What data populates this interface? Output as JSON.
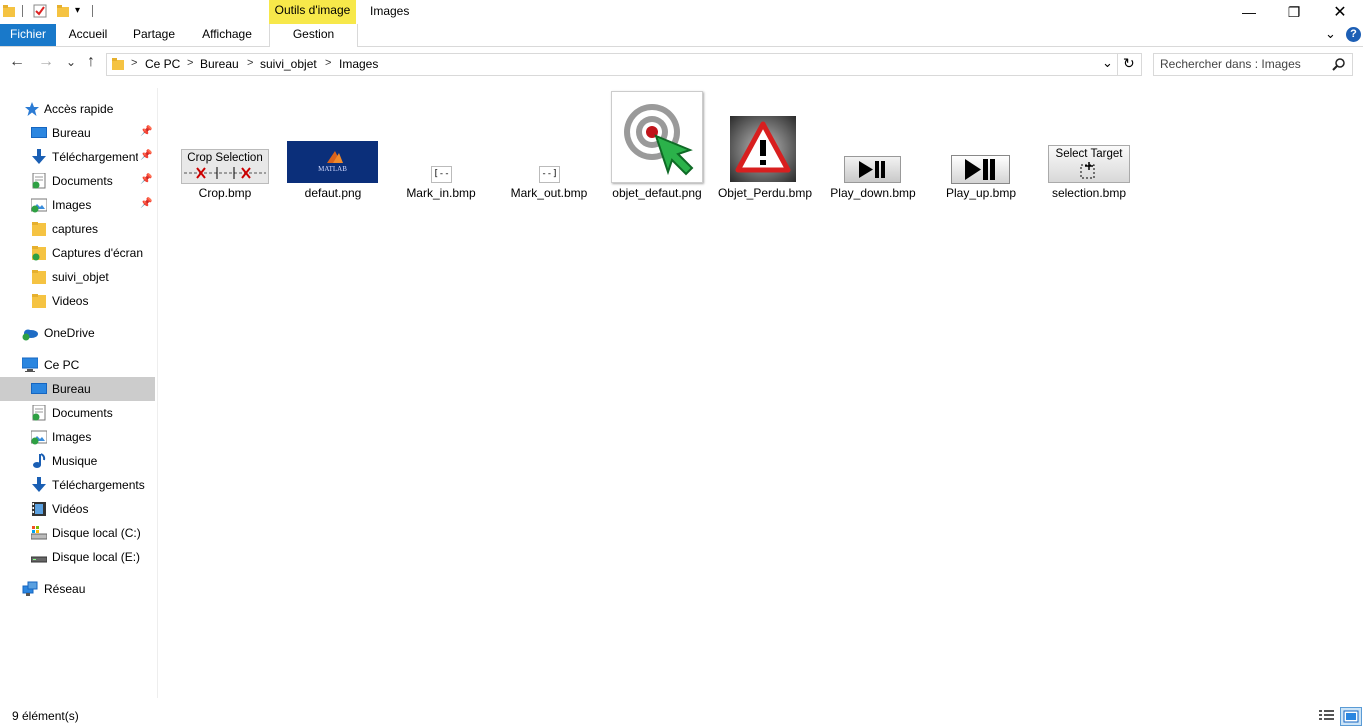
{
  "titlebar": {
    "context_tab": "Outils d'image",
    "title": "Images",
    "minimize": "—",
    "restore": "❐",
    "close": "✕"
  },
  "ribbon": {
    "tabs": [
      "Fichier",
      "Accueil",
      "Partage",
      "Affichage",
      "Gestion"
    ],
    "expand": "⌄",
    "help": "?"
  },
  "nav": {
    "back": "←",
    "forward": "→",
    "recent": "⌄",
    "up": "↑",
    "breadcrumb": [
      "Ce PC",
      "Bureau",
      "suivi_objet",
      "Images"
    ],
    "separator": ">",
    "dropdown": "⌄",
    "refresh": "↻",
    "search_placeholder": "Rechercher dans : Images",
    "search_icon": "search-icon"
  },
  "sidebar": {
    "quick_access": {
      "label": "Accès rapide",
      "items": [
        {
          "label": "Bureau",
          "pinned": true,
          "icon": "desktop-icon"
        },
        {
          "label": "Téléchargements",
          "pinned": true,
          "icon": "download-icon"
        },
        {
          "label": "Documents",
          "pinned": true,
          "icon": "documents-icon"
        },
        {
          "label": "Images",
          "pinned": true,
          "icon": "pictures-icon"
        },
        {
          "label": "captures",
          "pinned": false,
          "icon": "folder-icon"
        },
        {
          "label": "Captures d'écran",
          "pinned": false,
          "icon": "folder-sync-icon"
        },
        {
          "label": "suivi_objet",
          "pinned": false,
          "icon": "folder-icon"
        },
        {
          "label": "Videos",
          "pinned": false,
          "icon": "folder-icon"
        }
      ]
    },
    "onedrive": {
      "label": "OneDrive"
    },
    "this_pc": {
      "label": "Ce PC",
      "items": [
        {
          "label": "Bureau",
          "icon": "desktop-icon",
          "selected": true
        },
        {
          "label": "Documents",
          "icon": "documents-icon"
        },
        {
          "label": "Images",
          "icon": "pictures-icon"
        },
        {
          "label": "Musique",
          "icon": "music-icon"
        },
        {
          "label": "Téléchargements",
          "icon": "download-icon"
        },
        {
          "label": "Vidéos",
          "icon": "videos-icon"
        },
        {
          "label": "Disque local (C:)",
          "icon": "drive-c-icon"
        },
        {
          "label": "Disque local (E:)",
          "icon": "drive-e-icon"
        }
      ]
    },
    "network": {
      "label": "Réseau"
    }
  },
  "files": [
    {
      "name": "Crop.bmp",
      "thumb_text": "Crop Selection"
    },
    {
      "name": "defaut.png",
      "thumb_text": "MATLAB"
    },
    {
      "name": "Mark_in.bmp",
      "thumb_text": "[--"
    },
    {
      "name": "Mark_out.bmp",
      "thumb_text": "--]"
    },
    {
      "name": "objet_defaut.png",
      "thumb_text": ""
    },
    {
      "name": "Objet_Perdu.bmp",
      "thumb_text": "!"
    },
    {
      "name": "Play_down.bmp",
      "thumb_text": ""
    },
    {
      "name": "Play_up.bmp",
      "thumb_text": ""
    },
    {
      "name": "selection.bmp",
      "thumb_text": "Select Target"
    }
  ],
  "status": {
    "count": "9 élément(s)"
  },
  "colors": {
    "accent": "#1979ca",
    "context_tab": "#f7e84a",
    "selected_bg": "#cccccc"
  }
}
